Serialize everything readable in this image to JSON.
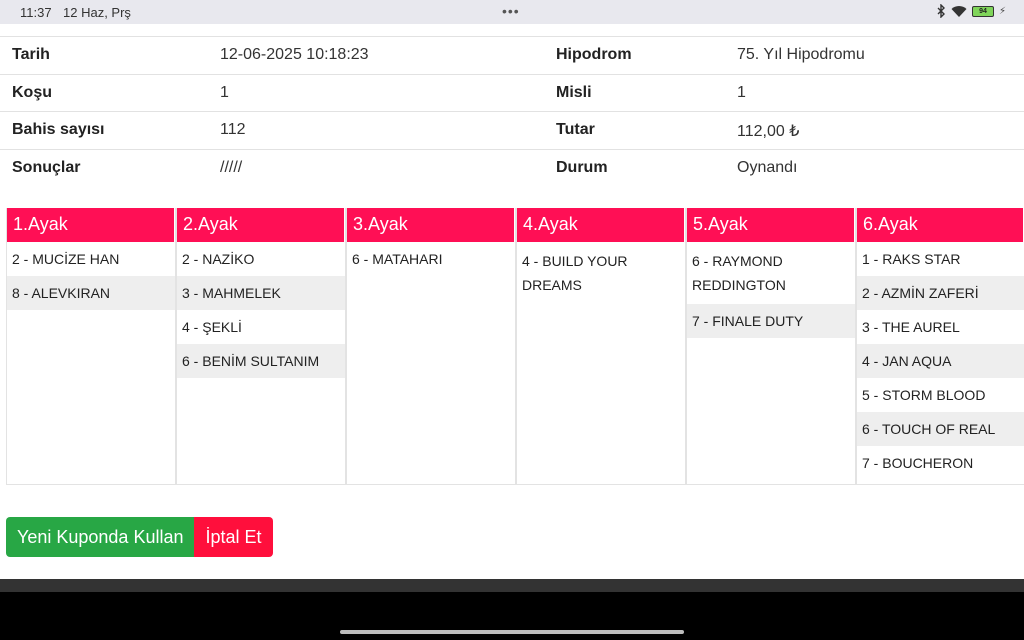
{
  "status": {
    "time": "11:37",
    "date": "12 Haz, Prş",
    "battery": "94"
  },
  "info": {
    "rows": [
      {
        "l1": "Tarih",
        "v1": "12-06-2025 10:18:23",
        "l2": "Hipodrom",
        "v2": "75. Yıl Hipodromu"
      },
      {
        "l1": "Koşu",
        "v1": "1",
        "l2": "Misli",
        "v2": "1"
      },
      {
        "l1": "Bahis sayısı",
        "v1": "112",
        "l2": "Tutar",
        "v2": "112,00 ₺"
      },
      {
        "l1": "Sonuçlar",
        "v1": "/////",
        "l2": "Durum",
        "v2": "Oynandı"
      }
    ]
  },
  "legs": [
    {
      "title": "1.Ayak",
      "horses": [
        "2 - MUCİZE HAN",
        "8 - ALEVKIRAN"
      ]
    },
    {
      "title": "2.Ayak",
      "horses": [
        "2 - NAZİKO",
        "3 - MAHMELEK",
        "4 - ŞEKLİ",
        "6 - BENİM SULTANIM"
      ]
    },
    {
      "title": "3.Ayak",
      "horses": [
        "6 - MATAHARI"
      ]
    },
    {
      "title": "4.Ayak",
      "horses": [
        "4 - BUILD YOUR DREAMS"
      ]
    },
    {
      "title": "5.Ayak",
      "horses": [
        "6 - RAYMOND REDDINGTON",
        "7 - FINALE DUTY"
      ]
    },
    {
      "title": "6.Ayak",
      "horses": [
        "1 - RAKS STAR",
        "2 - AZMİN ZAFERİ",
        "3 - THE AUREL",
        "4 - JAN AQUA",
        "5 - STORM BLOOD",
        "6 - TOUCH OF REAL",
        "7 - BOUCHERON"
      ]
    }
  ],
  "actions": {
    "reuse_label": "Yeni Kuponda Kullan",
    "cancel_label": "İptal Et"
  },
  "colors": {
    "accent": "#ff0f55",
    "green": "#28a745",
    "red": "#ff0f3c"
  }
}
